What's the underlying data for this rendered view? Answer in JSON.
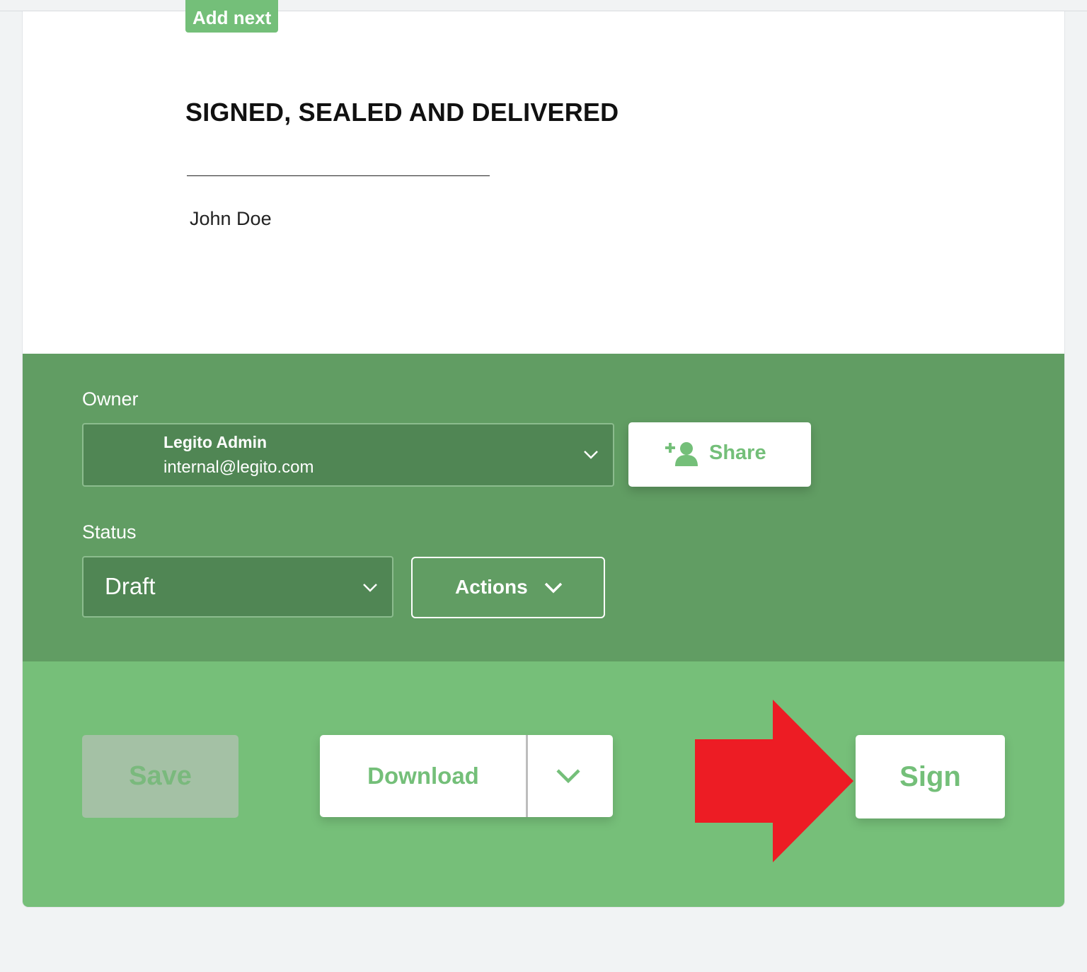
{
  "document": {
    "add_next_label": "Add next",
    "heading": "SIGNED, SEALED AND DELIVERED",
    "signer_name": "John Doe"
  },
  "owner": {
    "label": "Owner",
    "name": "Legito Admin",
    "email": "internal@legito.com"
  },
  "share": {
    "label": "Share",
    "icon": "add-user-icon"
  },
  "status": {
    "label": "Status",
    "value": "Draft"
  },
  "actions": {
    "label": "Actions"
  },
  "footer": {
    "save_label": "Save",
    "download_label": "Download",
    "sign_label": "Sign"
  },
  "colors": {
    "accent_green": "#74bf79",
    "panel_green": "#619d63",
    "select_green": "#508654",
    "action_bar_green": "#76bf79",
    "annotation_red": "#ed1c24"
  }
}
